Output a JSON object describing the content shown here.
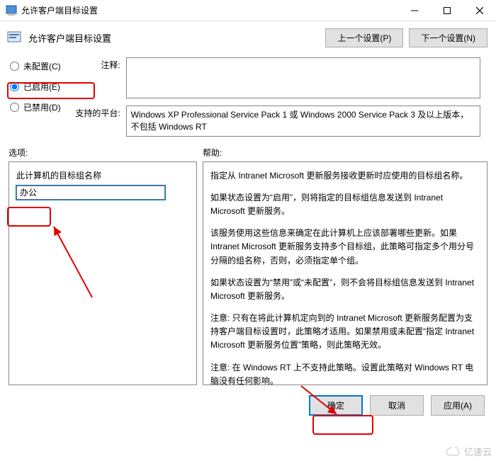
{
  "window": {
    "title": "允许客户端目标设置",
    "min_tooltip": "Minimize",
    "max_tooltip": "Maximize",
    "close_tooltip": "Close"
  },
  "header": {
    "title": "允许客户端目标设置",
    "prev_btn": "上一个设置(P)",
    "next_btn": "下一个设置(N)"
  },
  "radios": {
    "not_configured": "未配置(C)",
    "enabled": "已启用(E)",
    "disabled": "已禁用(D)"
  },
  "fields": {
    "comment_label": "注释:",
    "comment_value": "",
    "platform_label": "支持的平台:",
    "platform_value": "Windows XP Professional Service Pack 1 或 Windows 2000 Service Pack 3 及以上版本，不包括 Windows RT"
  },
  "panes": {
    "options_label": "选项:",
    "help_label": "帮助:"
  },
  "options": {
    "target_group_label": "此计算机的目标组名称",
    "target_group_value": "办公"
  },
  "help": {
    "p1": "指定从 Intranet Microsoft 更新服务接收更新时应使用的目标组名称。",
    "p2": "如果状态设置为“启用”，则将指定的目标组信息发送到 Intranet Microsoft 更新服务。",
    "p3": "该服务使用这些信息来确定在此计算机上应该部署哪些更新。如果 Intranet Microsoft 更新服务支持多个目标组，此策略可指定多个用分号分隔的组名称，否则，必须指定单个组。",
    "p4": "如果状态设置为“禁用”或“未配置”，则不会将目标组信息发送到 Intranet Microsoft 更新服务。",
    "p5": "注意: 只有在将此计算机定向到的 Intranet Microsoft 更新服务配置为支持客户端目标设置时，此策略才适用。如果禁用或未配置“指定 Intranet Microsoft 更新服务位置”策略，则此策略无效。",
    "p6": "注意: 在 Windows RT 上不支持此策略。设置此策略对 Windows RT 电脑没有任何影响。"
  },
  "footer": {
    "ok": "确定",
    "cancel": "取消",
    "apply": "应用(A)"
  },
  "watermark": {
    "text": "亿速云"
  },
  "colors": {
    "accent": "#0078d7",
    "highlight": "#e00000"
  }
}
